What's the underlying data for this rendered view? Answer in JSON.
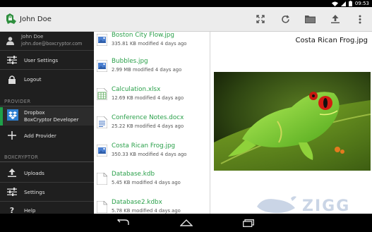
{
  "status": {
    "time": "09:53"
  },
  "app": {
    "title": "John Doe"
  },
  "user": {
    "name": "John Doe",
    "email": "john.doe@boxcryptor.com"
  },
  "sidebar": {
    "items_top": [
      {
        "label": "User Settings"
      },
      {
        "label": "Logout"
      }
    ],
    "provider_section": "PROVIDER",
    "provider": {
      "name": "Dropbox",
      "account": "BoxCryptor Developer"
    },
    "add_provider": "Add Provider",
    "boxcryptor_section": "BOXCRYPTOR",
    "items_bottom": [
      {
        "label": "Uploads"
      },
      {
        "label": "Settings"
      },
      {
        "label": "Help"
      }
    ]
  },
  "files": [
    {
      "name": "Boston City Flow.jpg",
      "meta": "335.81 KB modified 4 days ago",
      "icon": "image-file-icon"
    },
    {
      "name": "Bubbles.jpg",
      "meta": "2.99 MB modified 4 days ago",
      "icon": "image-file-icon"
    },
    {
      "name": "Calculation.xlsx",
      "meta": "12.69 KB modified 4 days ago",
      "icon": "spreadsheet-file-icon"
    },
    {
      "name": "Conference Notes.docx",
      "meta": "25.22 KB modified 4 days ago",
      "icon": "document-file-icon"
    },
    {
      "name": "Costa Rican Frog.jpg",
      "meta": "350.33 KB modified 4 days ago",
      "icon": "image-file-icon"
    },
    {
      "name": "Database.kdb",
      "meta": "5.45 KB modified 4 days ago",
      "icon": "generic-file-icon"
    },
    {
      "name": "Database2.kdbx",
      "meta": "5.78 KB modified 4 days ago",
      "icon": "generic-file-icon"
    }
  ],
  "preview": {
    "title": "Costa Rican Frog.jpg",
    "watermark": "ZIGG"
  },
  "colors": {
    "accent": "#2aa04a",
    "sidebar_bg": "#1f1f1f",
    "actionbar_bg": "#ececec"
  }
}
